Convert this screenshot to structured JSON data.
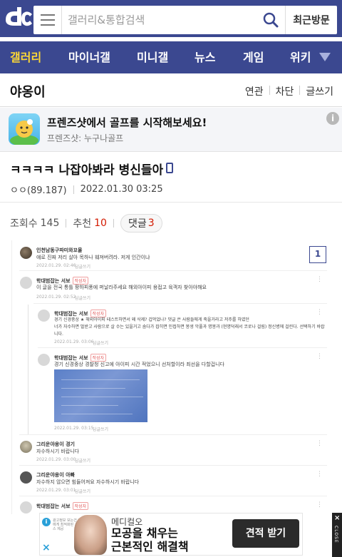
{
  "header": {
    "search_placeholder": "갤러리&통합검색",
    "recent_label": "최근방문"
  },
  "nav": {
    "items": [
      {
        "label": "갤러리"
      },
      {
        "label": "마이너갤"
      },
      {
        "label": "미니갤"
      },
      {
        "label": "뉴스"
      },
      {
        "label": "게임"
      },
      {
        "label": "위키"
      }
    ]
  },
  "gallery": {
    "title": "야옹이",
    "links": [
      "연관",
      "차단",
      "글쓰기"
    ]
  },
  "ad": {
    "title": "프렌즈샷에서 골프를 시작해보세요!",
    "sub": "프렌즈샷: 누구나골프",
    "info": "i"
  },
  "post": {
    "title": "ㅋㅋㅋㅋ 나잡아봐라 병신들아",
    "author": "ㅇㅇ(89.187)",
    "date": "2022.01.30 03:25",
    "views_label": "조회수",
    "views": "145",
    "recommend_label": "추천",
    "recommend": "10",
    "comments_label": "댓글",
    "comments": "3"
  },
  "screenshot": {
    "page_number": "1",
    "comments": [
      {
        "name": "인천남동구파미와꼬울",
        "text": "얘로 진짜 저리 살아 목하나 훼져버려라. 저게 인간이냐",
        "date": "2022.01.29. 02:46",
        "reply": "답글쓰기"
      },
      {
        "name": "학대범잡는 서보",
        "badge": "작성자",
        "text": "이 글을 전국 통틀 팡하피풍에 퍼날라주세요 해외아이피 용접고 육객자 찾아야해요",
        "date": "2022.01.29. 02:52",
        "reply": "답글쓰기"
      },
      {
        "name": "학대범잡는 서보",
        "badge": "작성자",
        "text": "경기 신경중상 ★ 해외아이피 테스트하면서 왜 삭제? 겁먹었나? 댓글 쓴 사람들에게 죽을거라고 저주를 하였던",
        "text2": "너가 자수하면 벌받고 사람으로 살 수는 있을거고 숨다가 잡히면 인접하면 봉생 악풀과 명봉과 (현명덕래서 코로나 걸림) 정신병에 걸린다. 선택하기 바랍니다.",
        "date": "2022.01.29. 03:06",
        "reply": "답글쓰기"
      },
      {
        "name": "학대범잡는 서보",
        "badge": "작성자",
        "text": "경기 신경중상 경찰청 신고에 아이피 시간 적었으니 선처할이라 죄선을 다할겁니다",
        "date": "2022.01.29. 03:15",
        "reply": "답글쓰기"
      },
      {
        "name": "그리운야옹이 경기",
        "text": "자수하시기 바랍니다",
        "date": "2022.01.29. 03:00",
        "reply": "답글쓰기"
      },
      {
        "name": "그리운야옹이 아빠",
        "text": "자수하지 않으면 힘들어져요 자수하시기 바랍니다",
        "date": "2022.01.29. 03:01",
        "reply": "답글쓰기"
      },
      {
        "name": "학대범잡는 서보",
        "badge": "작성자",
        "text": "",
        "date": "",
        "reply": ""
      }
    ]
  },
  "bottom_ad": {
    "brand": "메디컬오",
    "copy_line1": "모공을 채우는",
    "copy_line2": "근본적인 해결책",
    "cta": "견적 받기",
    "tiny": "광고정보 보는건 나에게 최적화된 서비스 제공",
    "close_label": "CLOSE",
    "close_x": "×"
  }
}
